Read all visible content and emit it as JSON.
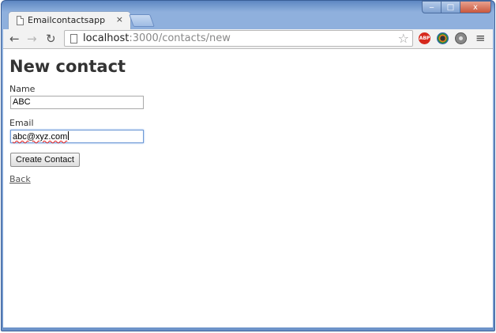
{
  "browser": {
    "tab_title": "Emailcontactsapp",
    "tab_close": "×",
    "url_host": "localhost",
    "url_rest": ":3000/contacts/new",
    "window_controls": {
      "minimize": "‒",
      "maximize": "□",
      "close": "x"
    },
    "extensions": {
      "abp": "ABP"
    },
    "colors": {
      "frame": "#8fb0dd",
      "abp": "#d6291d"
    }
  },
  "page": {
    "heading": "New contact",
    "name_label": "Name",
    "name_value": "ABC",
    "email_label": "Email",
    "email_value": "abc@xyz.com",
    "submit_label": "Create Contact",
    "back_link": "Back"
  }
}
